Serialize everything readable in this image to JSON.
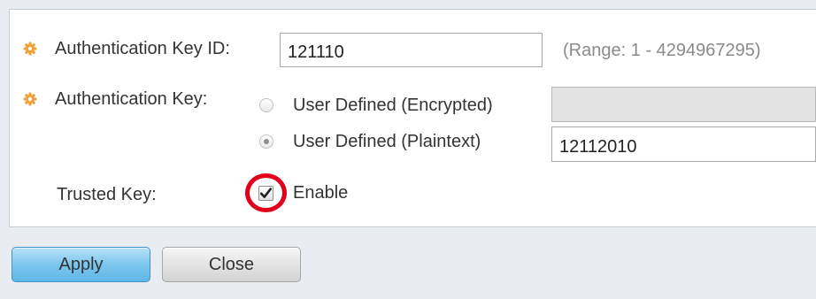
{
  "colors": {
    "page_background": "#e9edf2",
    "panel_background": "#ffffff",
    "required_icon": "#f0a23a",
    "highlight_ring": "#e3001b",
    "primary_button": "#7cc6ee",
    "hint_text": "#8a8a8a"
  },
  "form": {
    "key_id": {
      "label": "Authentication Key ID:",
      "value": "121110",
      "hint": "(Range: 1 - 4294967295)",
      "required_icon": "gear-icon"
    },
    "auth_key": {
      "label": "Authentication Key:",
      "required_icon": "gear-icon",
      "options": [
        {
          "label": "User Defined (Encrypted)",
          "selected": false,
          "value": "",
          "field_disabled": true
        },
        {
          "label": "User Defined (Plaintext)",
          "selected": true,
          "value": "12112010",
          "field_disabled": false
        }
      ]
    },
    "trusted_key": {
      "label": "Trusted Key:",
      "checkbox_label": "Enable",
      "checked": true,
      "checkmark_icon": "checkmark-icon"
    }
  },
  "buttons": {
    "apply_label": "Apply",
    "close_label": "Close"
  }
}
